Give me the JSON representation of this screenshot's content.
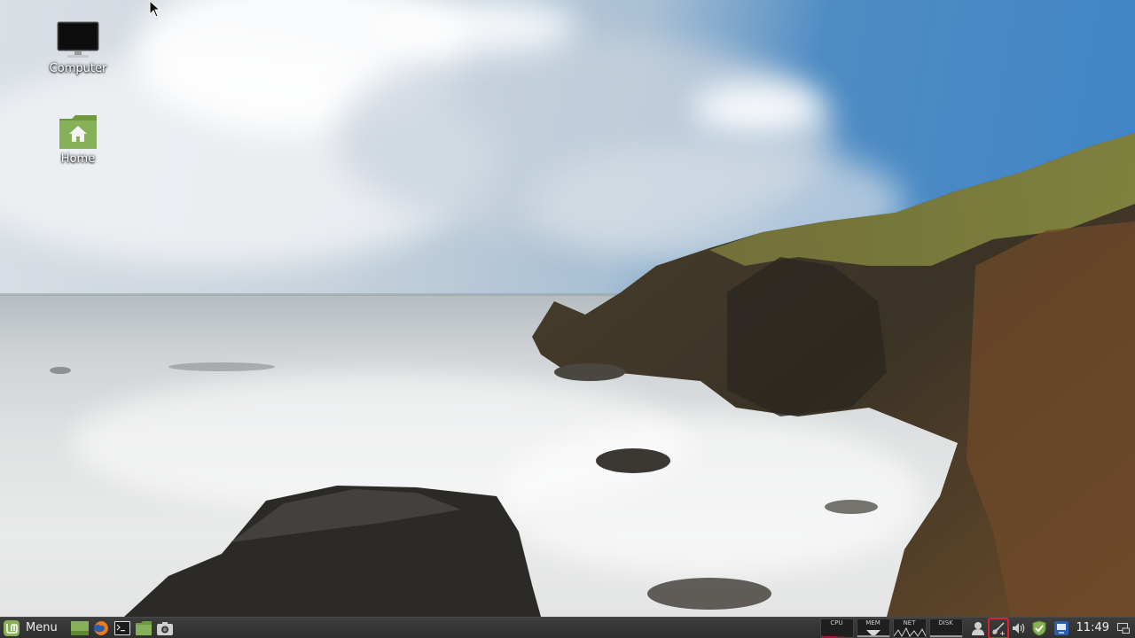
{
  "desktop": {
    "icons": [
      {
        "label": "Computer",
        "icon": "computer-icon"
      },
      {
        "label": "Home",
        "icon": "home-folder-icon"
      }
    ]
  },
  "panel": {
    "menu_label": "Menu",
    "launchers": [
      "show-desktop-icon",
      "firefox-icon",
      "terminal-icon",
      "files-icon",
      "screenshot-icon"
    ],
    "monitors": [
      {
        "label": "CPU"
      },
      {
        "label": "MEM"
      },
      {
        "label": "NET"
      },
      {
        "label": "DISK"
      }
    ],
    "tray_icons": [
      "user-icon",
      "network-disconnected-icon",
      "volume-icon",
      "update-manager-shield-icon",
      "display-icon"
    ],
    "clock": "11:49",
    "show_desktop_icon": "show-desktop-icon"
  },
  "colors": {
    "mint_green": "#87b158",
    "panel_bg": "#353535",
    "highlight": "#e0202c"
  }
}
